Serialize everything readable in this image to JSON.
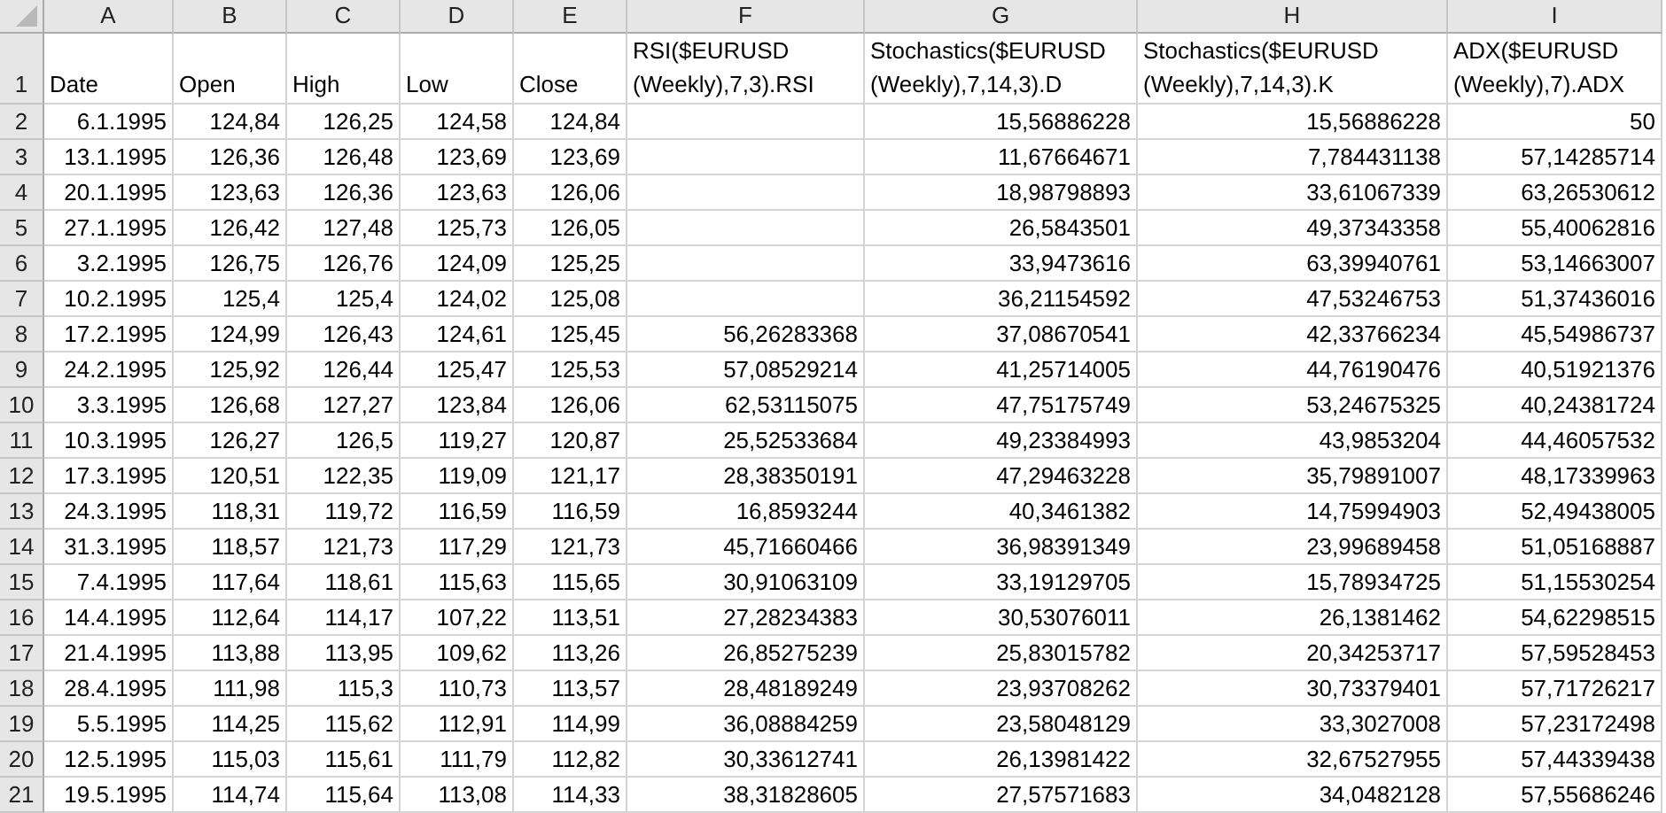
{
  "header_row": "1",
  "columns": [
    {
      "letter": "A",
      "header": "Date"
    },
    {
      "letter": "B",
      "header": "Open"
    },
    {
      "letter": "C",
      "header": "High"
    },
    {
      "letter": "D",
      "header": "Low"
    },
    {
      "letter": "E",
      "header": "Close"
    },
    {
      "letter": "F",
      "header": "RSI($EURUSD (Weekly),7,3).RSI"
    },
    {
      "letter": "G",
      "header": "Stochastics($EURUSD (Weekly),7,14,3).D"
    },
    {
      "letter": "H",
      "header": "Stochastics($EURUSD (Weekly),7,14,3).K"
    },
    {
      "letter": "I",
      "header": "ADX($EURUSD (Weekly),7).ADX"
    }
  ],
  "rows": [
    {
      "number": "2",
      "cells": {
        "A": "6.1.1995",
        "B": "124,84",
        "C": "126,25",
        "D": "124,58",
        "E": "124,84",
        "G": "15,56886228",
        "H": "15,56886228",
        "I": "50"
      }
    },
    {
      "number": "3",
      "cells": {
        "A": "13.1.1995",
        "B": "126,36",
        "C": "126,48",
        "D": "123,69",
        "E": "123,69",
        "G": "11,67664671",
        "H": "7,784431138",
        "I": "57,14285714"
      }
    },
    {
      "number": "4",
      "cells": {
        "A": "20.1.1995",
        "B": "123,63",
        "C": "126,36",
        "D": "123,63",
        "E": "126,06",
        "G": "18,98798893",
        "H": "33,61067339",
        "I": "63,26530612"
      }
    },
    {
      "number": "5",
      "cells": {
        "A": "27.1.1995",
        "B": "126,42",
        "C": "127,48",
        "D": "125,73",
        "E": "126,05",
        "G": "26,5843501",
        "H": "49,37343358",
        "I": "55,40062816"
      }
    },
    {
      "number": "6",
      "cells": {
        "A": "3.2.1995",
        "B": "126,75",
        "C": "126,76",
        "D": "124,09",
        "E": "125,25",
        "G": "33,9473616",
        "H": "63,39940761",
        "I": "53,14663007"
      }
    },
    {
      "number": "7",
      "cells": {
        "A": "10.2.1995",
        "B": "125,4",
        "C": "125,4",
        "D": "124,02",
        "E": "125,08",
        "G": "36,21154592",
        "H": "47,53246753",
        "I": "51,37436016"
      }
    },
    {
      "number": "8",
      "cells": {
        "A": "17.2.1995",
        "B": "124,99",
        "C": "126,43",
        "D": "124,61",
        "E": "125,45",
        "F": "56,26283368",
        "G": "37,08670541",
        "H": "42,33766234",
        "I": "45,54986737"
      }
    },
    {
      "number": "9",
      "cells": {
        "A": "24.2.1995",
        "B": "125,92",
        "C": "126,44",
        "D": "125,47",
        "E": "125,53",
        "F": "57,08529214",
        "G": "41,25714005",
        "H": "44,76190476",
        "I": "40,51921376"
      }
    },
    {
      "number": "10",
      "cells": {
        "A": "3.3.1995",
        "B": "126,68",
        "C": "127,27",
        "D": "123,84",
        "E": "126,06",
        "F": "62,53115075",
        "G": "47,75175749",
        "H": "53,24675325",
        "I": "40,24381724"
      }
    },
    {
      "number": "11",
      "cells": {
        "A": "10.3.1995",
        "B": "126,27",
        "C": "126,5",
        "D": "119,27",
        "E": "120,87",
        "F": "25,52533684",
        "G": "49,23384993",
        "H": "43,9853204",
        "I": "44,46057532"
      }
    },
    {
      "number": "12",
      "cells": {
        "A": "17.3.1995",
        "B": "120,51",
        "C": "122,35",
        "D": "119,09",
        "E": "121,17",
        "F": "28,38350191",
        "G": "47,29463228",
        "H": "35,79891007",
        "I": "48,17339963"
      }
    },
    {
      "number": "13",
      "cells": {
        "A": "24.3.1995",
        "B": "118,31",
        "C": "119,72",
        "D": "116,59",
        "E": "116,59",
        "F": "16,8593244",
        "G": "40,3461382",
        "H": "14,75994903",
        "I": "52,49438005"
      }
    },
    {
      "number": "14",
      "cells": {
        "A": "31.3.1995",
        "B": "118,57",
        "C": "121,73",
        "D": "117,29",
        "E": "121,73",
        "F": "45,71660466",
        "G": "36,98391349",
        "H": "23,99689458",
        "I": "51,05168887"
      }
    },
    {
      "number": "15",
      "cells": {
        "A": "7.4.1995",
        "B": "117,64",
        "C": "118,61",
        "D": "115,63",
        "E": "115,65",
        "F": "30,91063109",
        "G": "33,19129705",
        "H": "15,78934725",
        "I": "51,15530254"
      }
    },
    {
      "number": "16",
      "cells": {
        "A": "14.4.1995",
        "B": "112,64",
        "C": "114,17",
        "D": "107,22",
        "E": "113,51",
        "F": "27,28234383",
        "G": "30,53076011",
        "H": "26,1381462",
        "I": "54,62298515"
      }
    },
    {
      "number": "17",
      "cells": {
        "A": "21.4.1995",
        "B": "113,88",
        "C": "113,95",
        "D": "109,62",
        "E": "113,26",
        "F": "26,85275239",
        "G": "25,83015782",
        "H": "20,34253717",
        "I": "57,59528453"
      }
    },
    {
      "number": "18",
      "cells": {
        "A": "28.4.1995",
        "B": "111,98",
        "C": "115,3",
        "D": "110,73",
        "E": "113,57",
        "F": "28,48189249",
        "G": "23,93708262",
        "H": "30,73379401",
        "I": "57,71726217"
      }
    },
    {
      "number": "19",
      "cells": {
        "A": "5.5.1995",
        "B": "114,25",
        "C": "115,62",
        "D": "112,91",
        "E": "114,99",
        "F": "36,08884259",
        "G": "23,58048129",
        "H": "33,3027008",
        "I": "57,23172498"
      }
    },
    {
      "number": "20",
      "cells": {
        "A": "12.5.1995",
        "B": "115,03",
        "C": "115,61",
        "D": "111,79",
        "E": "112,82",
        "F": "30,33612741",
        "G": "26,13981422",
        "H": "32,67527955",
        "I": "57,44339438"
      }
    },
    {
      "number": "21",
      "cells": {
        "A": "19.5.1995",
        "B": "114,74",
        "C": "115,64",
        "D": "113,08",
        "E": "114,33",
        "F": "38,31828605",
        "G": "27,57571683",
        "H": "34,0482128",
        "I": "57,55686246"
      }
    }
  ]
}
